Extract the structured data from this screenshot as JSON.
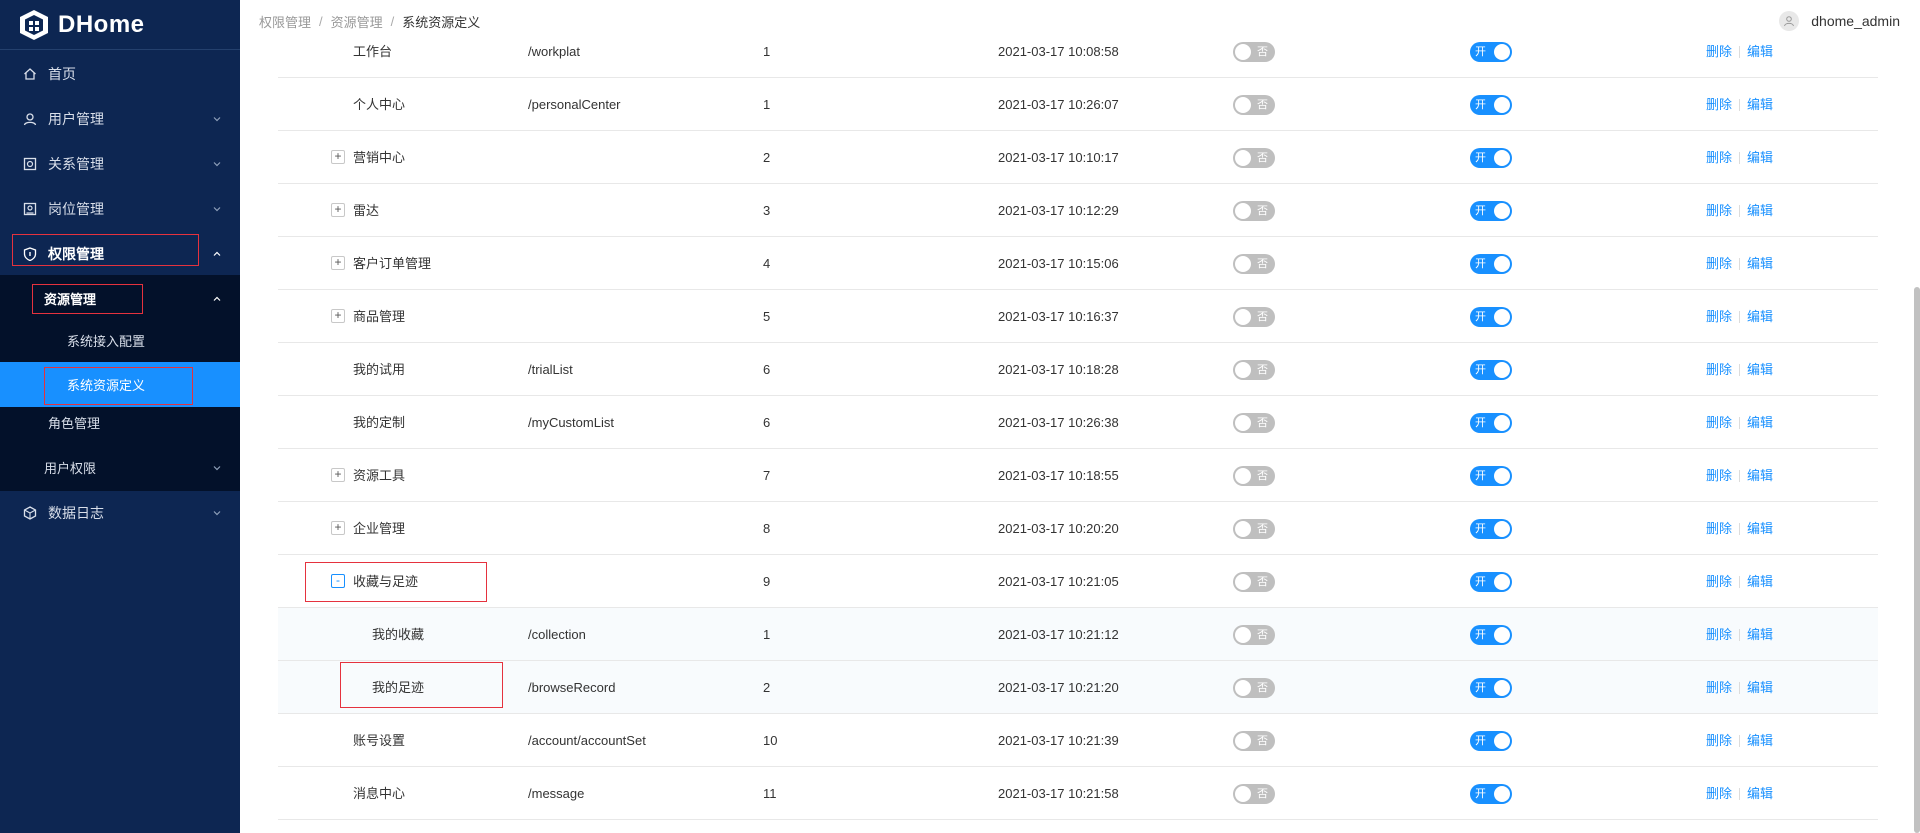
{
  "app": {
    "name": "DHome"
  },
  "colors": {
    "sidebar_bg": "#0d2652",
    "submenu_bg": "#03112a",
    "accent": "#1890ff",
    "highlight_box": "#e5323e",
    "switch_off": "#bfbfbf"
  },
  "header": {
    "breadcrumb": [
      "权限管理",
      "资源管理",
      "系统资源定义"
    ],
    "username": "dhome_admin"
  },
  "sidebar": {
    "items": [
      {
        "label": "首页",
        "icon": "home-icon"
      },
      {
        "label": "用户管理",
        "icon": "user-icon"
      },
      {
        "label": "关系管理",
        "icon": "relation-icon"
      },
      {
        "label": "岗位管理",
        "icon": "post-icon"
      },
      {
        "label": "权限管理",
        "icon": "shield-icon",
        "expanded": true
      },
      {
        "label": "数据日志",
        "icon": "log-icon"
      }
    ],
    "sub": {
      "resource_mgmt": "资源管理",
      "access_config": "系统接入配置",
      "resource_def": "系统资源定义",
      "role_mgmt": "角色管理",
      "user_perm": "用户权限"
    }
  },
  "table": {
    "rows": [
      {
        "name": "工作台",
        "path": "/workplat",
        "order": "1",
        "time": "2021-03-17 10:08:58",
        "expander": "",
        "level": 0
      },
      {
        "name": "个人中心",
        "path": "/personalCenter",
        "order": "1",
        "time": "2021-03-17 10:26:07",
        "expander": "",
        "level": 0
      },
      {
        "name": "营销中心",
        "path": "",
        "order": "2",
        "time": "2021-03-17 10:10:17",
        "expander": "+",
        "level": 0
      },
      {
        "name": "雷达",
        "path": "",
        "order": "3",
        "time": "2021-03-17 10:12:29",
        "expander": "+",
        "level": 0
      },
      {
        "name": "客户订单管理",
        "path": "",
        "order": "4",
        "time": "2021-03-17 10:15:06",
        "expander": "+",
        "level": 0
      },
      {
        "name": "商品管理",
        "path": "",
        "order": "5",
        "time": "2021-03-17 10:16:37",
        "expander": "+",
        "level": 0
      },
      {
        "name": "我的试用",
        "path": "/trialList",
        "order": "6",
        "time": "2021-03-17 10:18:28",
        "expander": "",
        "level": 0
      },
      {
        "name": "我的定制",
        "path": "/myCustomList",
        "order": "6",
        "time": "2021-03-17 10:26:38",
        "expander": "",
        "level": 0
      },
      {
        "name": "资源工具",
        "path": "",
        "order": "7",
        "time": "2021-03-17 10:18:55",
        "expander": "+",
        "level": 0
      },
      {
        "name": "企业管理",
        "path": "",
        "order": "8",
        "time": "2021-03-17 10:20:20",
        "expander": "+",
        "level": 0
      },
      {
        "name": "收藏与足迹",
        "path": "",
        "order": "9",
        "time": "2021-03-17 10:21:05",
        "expander": "-",
        "level": 0
      },
      {
        "name": "我的收藏",
        "path": "/collection",
        "order": "1",
        "time": "2021-03-17 10:21:12",
        "expander": "",
        "level": 1
      },
      {
        "name": "我的足迹",
        "path": "/browseRecord",
        "order": "2",
        "time": "2021-03-17 10:21:20",
        "expander": "",
        "level": 1
      },
      {
        "name": "账号设置",
        "path": "/account/accountSet",
        "order": "10",
        "time": "2021-03-17 10:21:39",
        "expander": "",
        "level": 0
      },
      {
        "name": "消息中心",
        "path": "/message",
        "order": "11",
        "time": "2021-03-17 10:21:58",
        "expander": "",
        "level": 0
      }
    ],
    "switch_off_label": "否",
    "switch_on_label": "开",
    "delete_label": "删除",
    "edit_label": "编辑"
  }
}
